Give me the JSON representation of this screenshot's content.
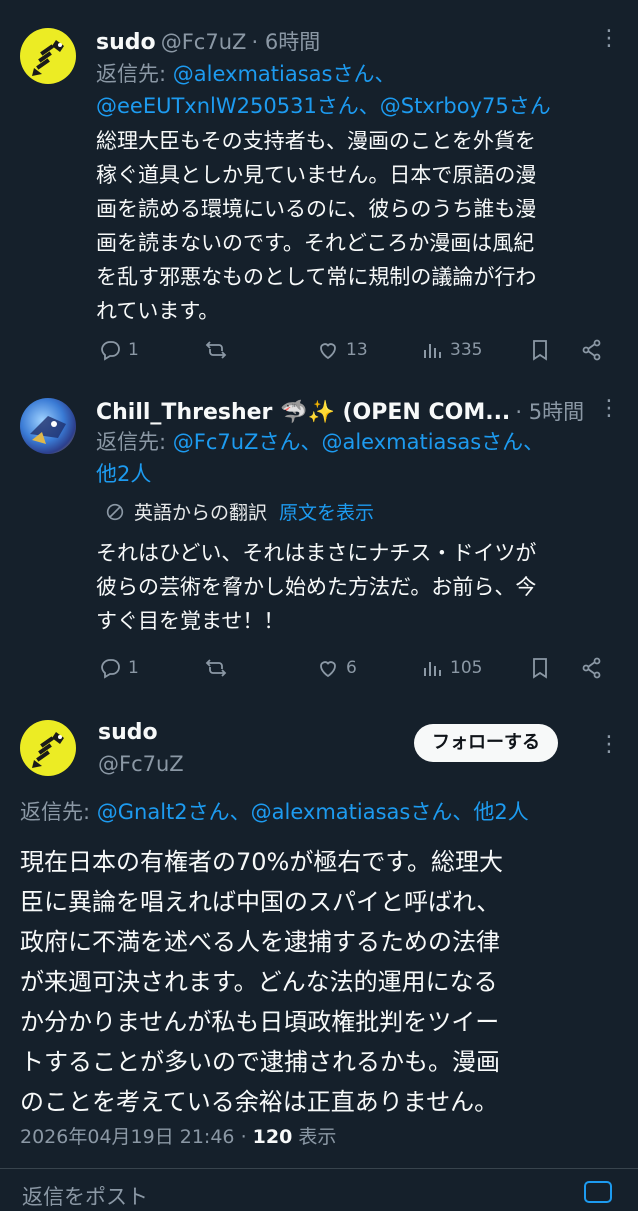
{
  "tweet1": {
    "name": "sudo",
    "handle": "@Fc7uZ",
    "time": "· 6時間",
    "reply_prefix": "返信先:",
    "reply_to_line1": "@alexmatiasasさん、",
    "reply_to_line2": "@eeEUTxnlW250531さん、@Stxrboy75さん",
    "body_lines": [
      "総理大臣もその支持者も、漫画のことを外貨を",
      "稼ぐ道具としか見ていません。日本で原語の漫",
      "画を読める環境にいるのに、彼らのうち誰も漫",
      "画を読まないのです。それどころか漫画は風紀",
      "を乱す邪悪なものとして常に規制の議論が行わ",
      "れています。"
    ],
    "replies": "1",
    "likes": "13",
    "views": "335"
  },
  "tweet2": {
    "name": "Chill_Thresher 🦈✨ (OPEN COM...",
    "time": "· 5時間",
    "reply_prefix": "返信先:",
    "reply_to_line1": "@Fc7uZさん、@alexmatiasasさん、",
    "reply_to_line2": "他2人",
    "translated_from": "英語からの翻訳",
    "show_original": "原文を表示",
    "body_lines": [
      "それはひどい、それはまさにナチス・ドイツが",
      "彼らの芸術を脅かし始めた方法だ。お前ら、今",
      "すぐ目を覚ませ！！"
    ],
    "replies": "1",
    "likes": "6",
    "views": "105"
  },
  "tweet3": {
    "name": "sudo",
    "handle": "@Fc7uZ",
    "follow_label": "フォローする",
    "reply_prefix": "返信先:",
    "reply_to": "@Gnalt2さん、@alexmatiasasさん、他2人",
    "body_lines": [
      "現在日本の有権者の70%が極右です。総理大",
      "臣に異論を唱えれば中国のスパイと呼ばれ、",
      "政府に不満を述べる人を逮捕するための法律",
      "が来週可決されます。どんな法的運用になる",
      "か分かりませんが私も日頃政権批判をツイー",
      "トすることが多いので逮捕されるかも。漫画",
      "のことを考えている余裕は正直ありません。"
    ],
    "timestamp": "2026年04月19日 21:46",
    "view_count": "120",
    "view_label": "表示"
  },
  "compose": {
    "placeholder": "返信をポスト"
  },
  "colors": {
    "background": "#15202b",
    "accent": "#1d9bf0",
    "muted": "#8b98a5"
  }
}
